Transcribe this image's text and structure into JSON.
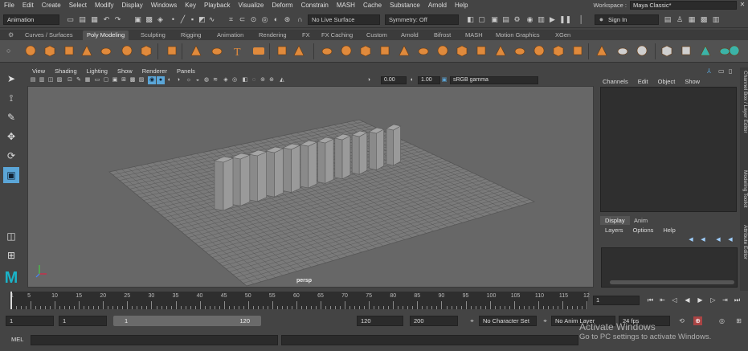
{
  "colors": {
    "ui_bg": "#444444",
    "viewport_bg": "#676767",
    "shelf_orange": "#e08a3c",
    "accent_blue": "#5ba6d8",
    "maya_logo": "#1ab3c8"
  },
  "menubar": {
    "items": [
      "File",
      "Edit",
      "Create",
      "Select",
      "Modify",
      "Display",
      "Windows",
      "Key",
      "Playback",
      "Visualize",
      "Deform",
      "Constrain",
      "MASH",
      "Cache",
      "Substance",
      "Arnold",
      "Help"
    ],
    "workspace_label": "Workspace :",
    "workspace_value": "Maya Classic*"
  },
  "statusline": {
    "mode": "Animation",
    "live_surface": "No Live Surface",
    "symmetry": "Symmetry: Off",
    "sign_in": "Sign In"
  },
  "shelf": {
    "tabs": [
      "Curves / Surfaces",
      "Poly Modeling",
      "Sculpting",
      "Rigging",
      "Animation",
      "Rendering",
      "FX",
      "FX Caching",
      "Custom",
      "Arnold",
      "Bifrost",
      "MASH",
      "Motion Graphics",
      "XGen"
    ],
    "active_tab": "Poly Modeling"
  },
  "panel": {
    "menus": [
      "View",
      "Shading",
      "Lighting",
      "Show",
      "Renderer",
      "Panels"
    ],
    "exposure": "0.00",
    "gamma": "1.00",
    "color_space": "sRGB gamma",
    "camera_label": "persp"
  },
  "channel_box": {
    "menus": [
      "Channels",
      "Edit",
      "Object",
      "Show"
    ]
  },
  "layer_editor": {
    "tabs": [
      "Display",
      "Anim"
    ],
    "active_tab": "Display",
    "menus": [
      "Layers",
      "Options",
      "Help"
    ]
  },
  "side_tabs": [
    "Channel Box / Layer Editor",
    "Modeling Toolkit",
    "Attribute Editor"
  ],
  "timeline": {
    "ticks": [
      "5",
      "10",
      "15",
      "20",
      "25",
      "30",
      "35",
      "40",
      "45",
      "50",
      "55",
      "60",
      "65",
      "70",
      "75",
      "80",
      "85",
      "90",
      "95",
      "100",
      "105",
      "110",
      "115",
      "12"
    ],
    "start_tick": "1",
    "current_frame": "1"
  },
  "range": {
    "start": "1",
    "playback_start": "1",
    "range_start": "1",
    "range_end": "120",
    "playback_end": "120",
    "end": "200",
    "character_set": "No Character Set",
    "anim_layer": "No Anim Layer",
    "fps": "24 fps"
  },
  "cmdline": {
    "label": "MEL"
  },
  "activation": {
    "title": "Activate Windows",
    "subtitle": "Go to PC settings to activate Windows."
  }
}
